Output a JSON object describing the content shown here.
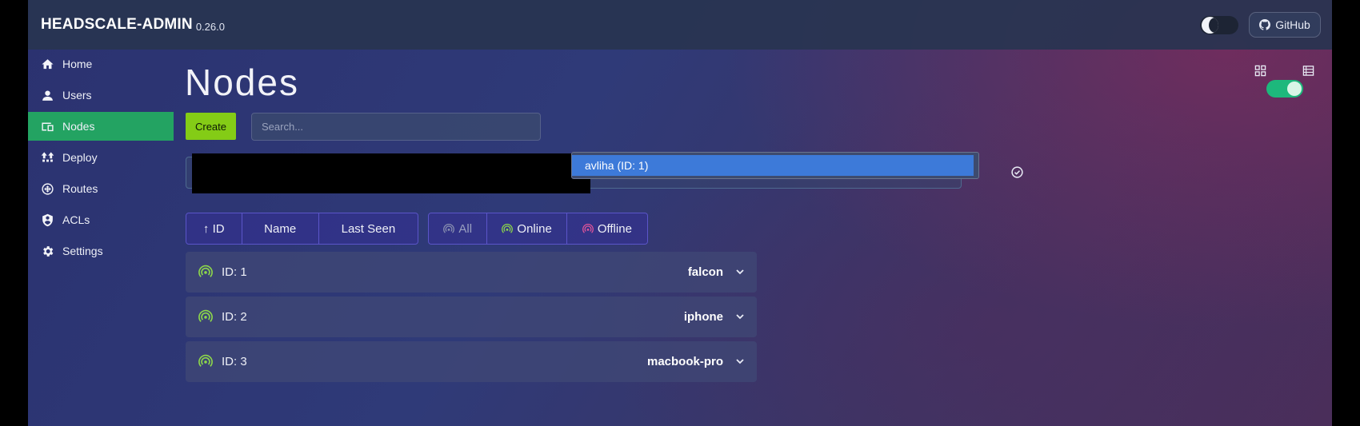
{
  "app": {
    "brand": "HEADSCALE-ADMIN",
    "version": "0.26.0"
  },
  "header": {
    "github_label": "GitHub"
  },
  "sidebar": {
    "items": [
      {
        "label": "Home",
        "icon": "home-icon"
      },
      {
        "label": "Users",
        "icon": "user-icon"
      },
      {
        "label": "Nodes",
        "icon": "devices-icon",
        "active": true
      },
      {
        "label": "Deploy",
        "icon": "deploy-icon"
      },
      {
        "label": "Routes",
        "icon": "routes-icon"
      },
      {
        "label": "ACLs",
        "icon": "shield-icon"
      },
      {
        "label": "Settings",
        "icon": "gear-icon"
      }
    ]
  },
  "main": {
    "title": "Nodes",
    "create_label": "Create",
    "search_placeholder": "Search...",
    "user_filter_selected": "avliha (ID: 1)",
    "sort_buttons": [
      "↑ ID",
      "Name",
      "Last Seen"
    ],
    "status_filters": [
      "All",
      "Online",
      "Offline"
    ],
    "nodes": [
      {
        "id_label": "ID: 1",
        "name": "falcon",
        "status": "online"
      },
      {
        "id_label": "ID: 2",
        "name": "iphone",
        "status": "online"
      },
      {
        "id_label": "ID: 3",
        "name": "macbook-pro",
        "status": "online"
      }
    ]
  },
  "colors": {
    "accent_green": "#23a362",
    "create_button": "#84cc16",
    "online": "#8dd84a",
    "offline": "#e0559a"
  }
}
